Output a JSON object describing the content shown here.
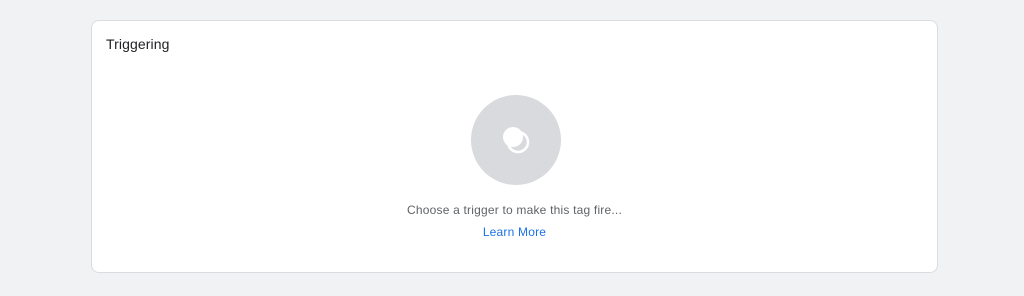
{
  "card": {
    "title": "Triggering",
    "empty_message": "Choose a trigger to make this tag fire...",
    "learn_more_label": "Learn More"
  },
  "icons": {
    "trigger_placeholder": "trigger-circles-icon"
  },
  "colors": {
    "page_background": "#f1f2f4",
    "card_background": "#ffffff",
    "card_border": "#dadce0",
    "placeholder_circle": "#d9dadd",
    "text_primary": "#202124",
    "text_secondary": "#5f6368",
    "link": "#1a73e8"
  }
}
